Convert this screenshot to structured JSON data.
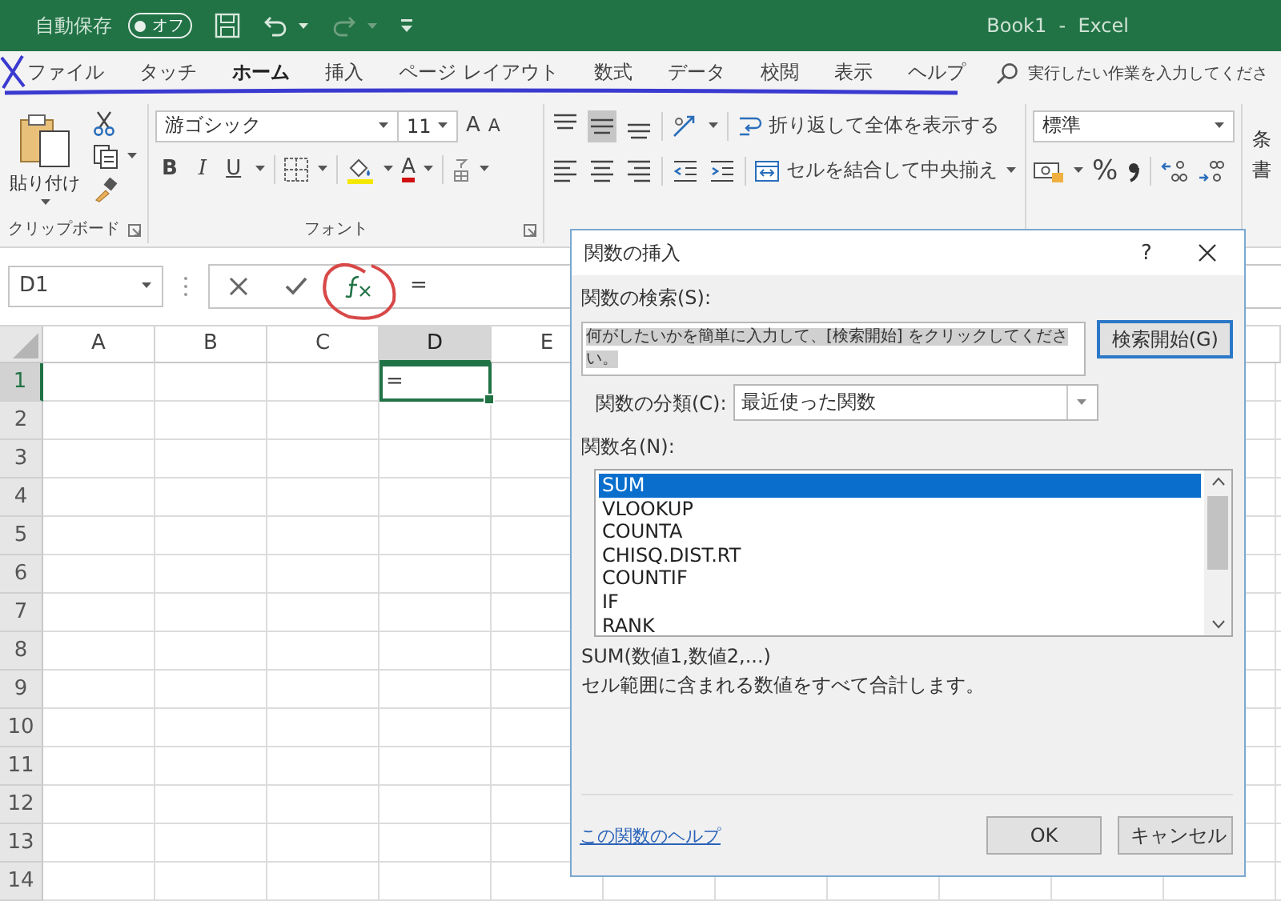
{
  "title_bar": {
    "autosave_label": "自動保存",
    "autosave_toggle": {
      "label": "オフ",
      "on": false
    },
    "title": "Book1  -  Excel"
  },
  "ribbon_tabs": [
    {
      "label": "ファイル",
      "selected": false
    },
    {
      "label": "タッチ",
      "selected": false
    },
    {
      "label": "ホーム",
      "selected": true
    },
    {
      "label": "挿入",
      "selected": false
    },
    {
      "label": "ページ レイアウト",
      "selected": false
    },
    {
      "label": "数式",
      "selected": false
    },
    {
      "label": "データ",
      "selected": false
    },
    {
      "label": "校閲",
      "selected": false
    },
    {
      "label": "表示",
      "selected": false
    },
    {
      "label": "ヘルプ",
      "selected": false
    }
  ],
  "tell_me": {
    "placeholder": "実行したい作業を入力してくださ"
  },
  "ribbon": {
    "clipboard": {
      "paste": "貼り付け",
      "group_label": "クリップボード"
    },
    "font": {
      "font_name": "游ゴシック",
      "font_size": "11",
      "grow": "A",
      "shrink": "A",
      "bold": "B",
      "italic": "I",
      "underline": "U",
      "font_color": "A",
      "group_label": "フォント"
    },
    "alignment": {
      "vertical_align": [
        {
          "selected": false
        },
        {
          "selected": true
        },
        {
          "selected": false
        }
      ],
      "wrap_text": "折り返して全体を表示する",
      "merge_center": "セルを結合して中央揃え"
    },
    "number": {
      "format": "標準",
      "percent": "%"
    },
    "styles_partial": {
      "line_1": "条",
      "line_2": "書"
    }
  },
  "formula_bar": {
    "name_box": "D1",
    "formula": "="
  },
  "sheet": {
    "columns": [
      {
        "label": "A",
        "selected": false
      },
      {
        "label": "B",
        "selected": false
      },
      {
        "label": "C",
        "selected": false
      },
      {
        "label": "D",
        "selected": true
      },
      {
        "label": "E",
        "selected": false
      }
    ],
    "rows": [
      {
        "label": "1",
        "selected": true
      },
      {
        "label": "2",
        "selected": false
      },
      {
        "label": "3",
        "selected": false
      },
      {
        "label": "4",
        "selected": false
      },
      {
        "label": "5",
        "selected": false
      },
      {
        "label": "6",
        "selected": false
      },
      {
        "label": "7",
        "selected": false
      },
      {
        "label": "8",
        "selected": false
      },
      {
        "label": "9",
        "selected": false
      },
      {
        "label": "10",
        "selected": false
      },
      {
        "label": "11",
        "selected": false
      },
      {
        "label": "12",
        "selected": false
      },
      {
        "label": "13",
        "selected": false
      },
      {
        "label": "14",
        "selected": false
      }
    ],
    "active_cell": {
      "value": "="
    }
  },
  "dialog": {
    "title": "関数の挿入",
    "help": "?",
    "search_label": "関数の検索(S):",
    "search_value": "何がしたいかを簡単に入力して、[検索開始] をクリックしてください。",
    "search_value_selected": true,
    "search_button": "検索開始(G)",
    "category_label": "関数の分類(C):",
    "category_value": "最近使った関数",
    "list_label": "関数名(N):",
    "functions": [
      {
        "name": "SUM",
        "selected": true
      },
      {
        "name": "VLOOKUP",
        "selected": false
      },
      {
        "name": "COUNTA",
        "selected": false
      },
      {
        "name": "CHISQ.DIST.RT",
        "selected": false
      },
      {
        "name": "COUNTIF",
        "selected": false
      },
      {
        "name": "IF",
        "selected": false
      },
      {
        "name": "RANK",
        "selected": false
      }
    ],
    "syntax": "SUM(数値1,数値2,...)",
    "description": "セル範囲に含まれる数値をすべて合計します。",
    "help_link": "この関数のヘルプ",
    "buttons": [
      {
        "label": "OK"
      },
      {
        "label": "キャンセル"
      }
    ]
  }
}
